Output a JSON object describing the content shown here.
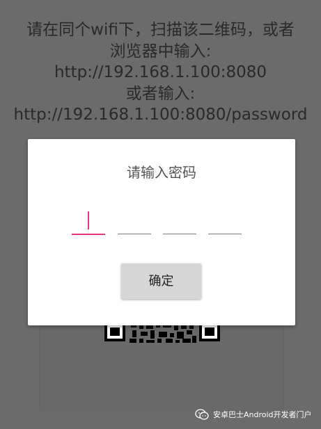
{
  "instructions": {
    "line1": "请在同个wifi下，扫描该二维码，或者",
    "line2": "浏览器中输入:",
    "line3": "http://192.168.1.100:8080",
    "line4": "或者输入:",
    "line5": "http://192.168.1.100:8080/password"
  },
  "dialog": {
    "title": "请输入密码",
    "pin_length": 4,
    "active_slot": 1,
    "confirm_label": "确定"
  },
  "watermark": {
    "icon": "wechat-icon",
    "text": "安卓巴士Android开发者门户"
  },
  "colors": {
    "overlay": "#6b6b6b",
    "accent": "#e0357d",
    "button": "#d6d6d6"
  }
}
